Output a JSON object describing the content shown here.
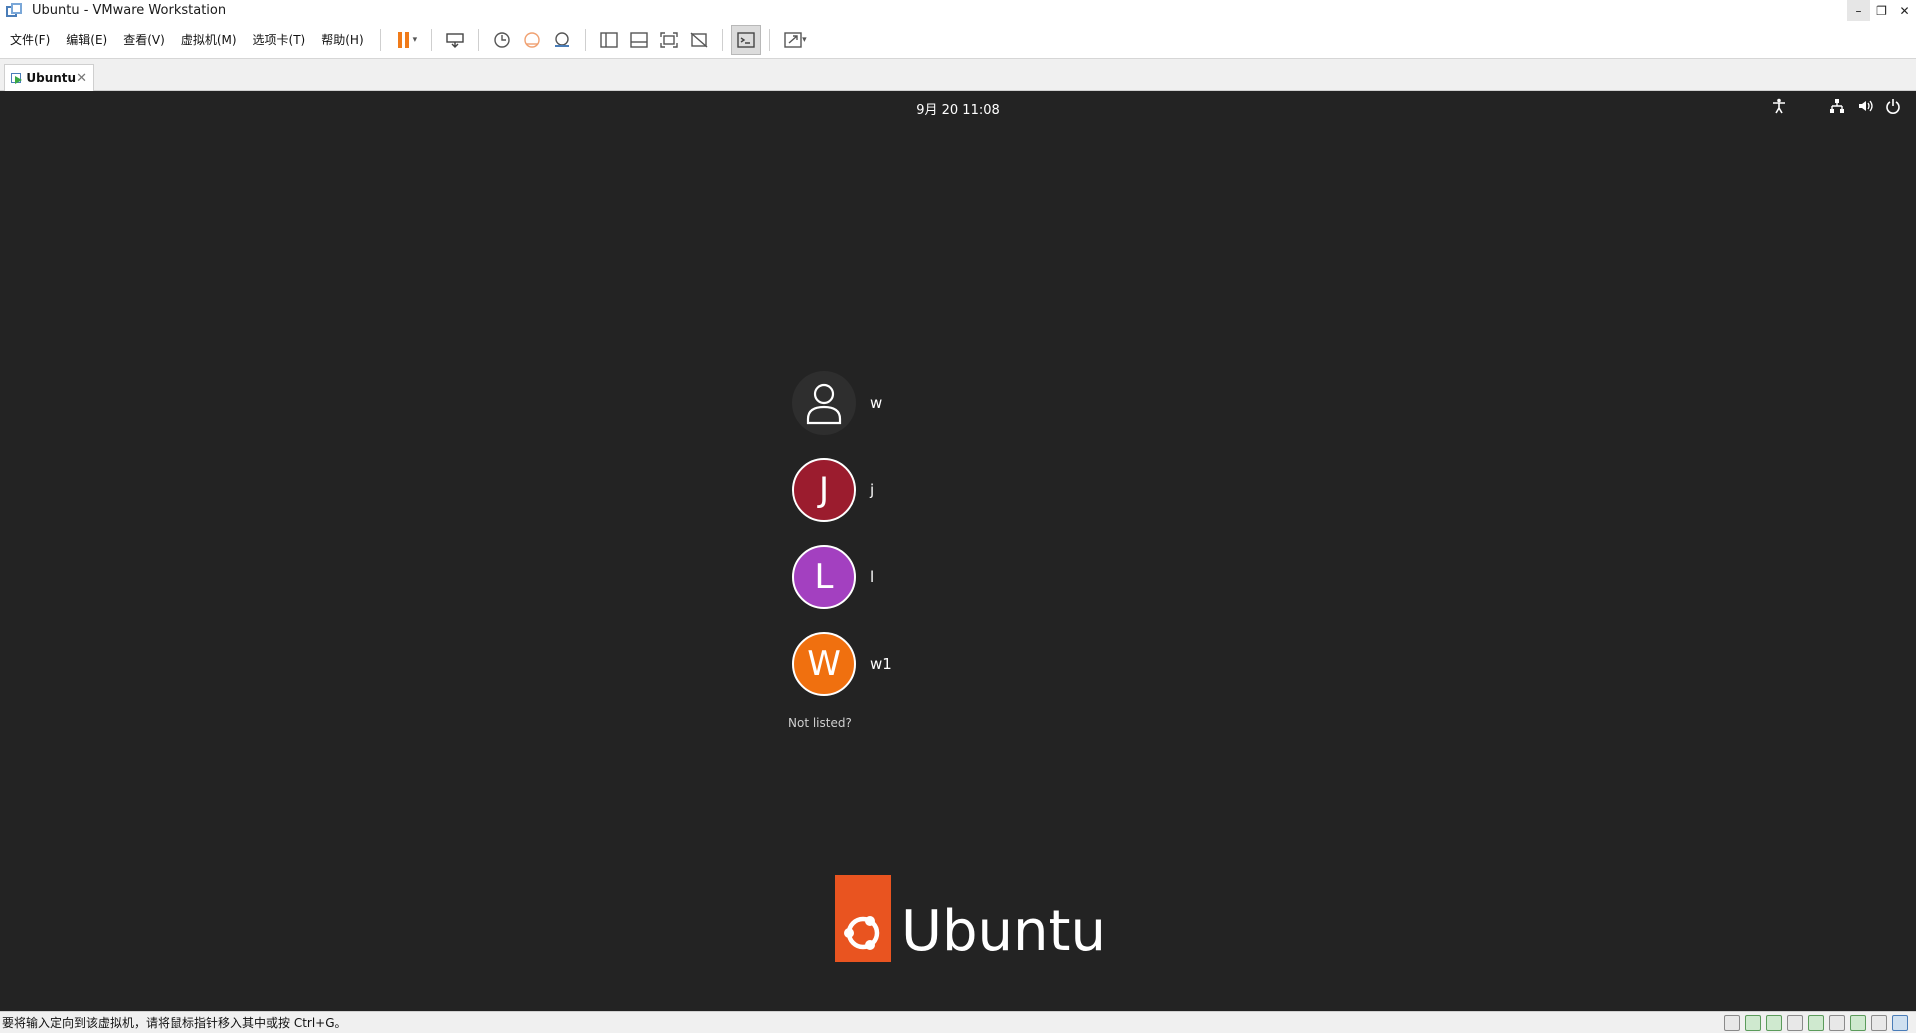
{
  "window": {
    "title": "Ubuntu - VMware Workstation",
    "minimize": "–",
    "restore": "❐",
    "close": "✕"
  },
  "menu": {
    "items": [
      "文件(F)",
      "编辑(E)",
      "查看(V)",
      "虚拟机(M)",
      "选项卡(T)",
      "帮助(H)"
    ]
  },
  "toolbar": {
    "caret": "▾"
  },
  "tab": {
    "label": "Ubuntu",
    "close": "✕"
  },
  "vm": {
    "clock": "9月 20  11:08",
    "users": [
      {
        "initial": "",
        "name": "w",
        "color": "#2e2e2e"
      },
      {
        "initial": "J",
        "name": "j",
        "color": "#9b1c2e"
      },
      {
        "initial": "L",
        "name": "l",
        "color": "#a340c0"
      },
      {
        "initial": "W",
        "name": "w1",
        "color": "#f0700f"
      }
    ],
    "not_listed": "Not listed?",
    "logo_text": "Ubuntu",
    "accent": "#e95420"
  },
  "status": {
    "text": "要将输入定向到该虚拟机，请将鼠标指针移入其中或按 Ctrl+G。"
  }
}
